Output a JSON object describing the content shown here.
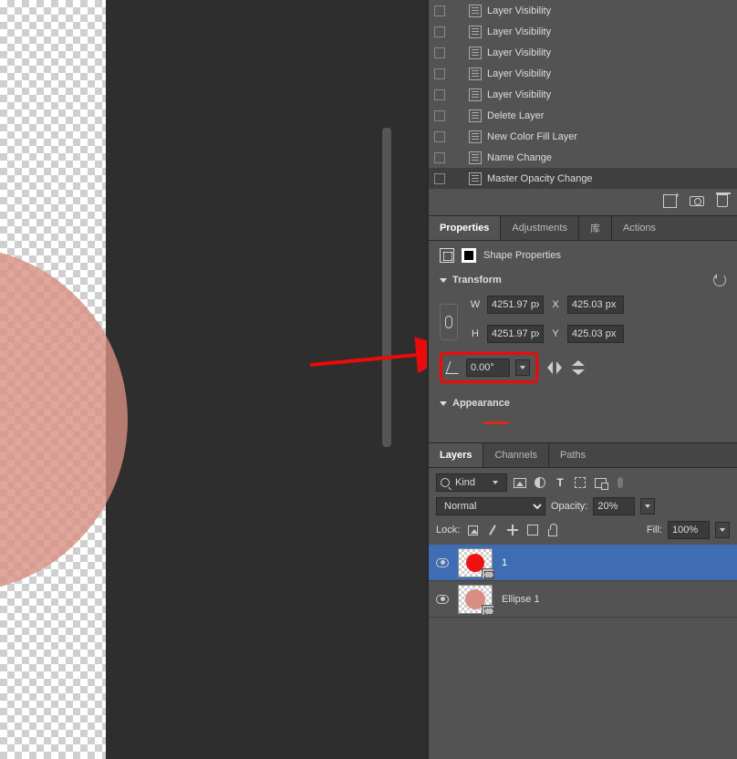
{
  "history": {
    "items": [
      {
        "label": "Layer Visibility",
        "selected": false
      },
      {
        "label": "Layer Visibility",
        "selected": false
      },
      {
        "label": "Layer Visibility",
        "selected": false
      },
      {
        "label": "Layer Visibility",
        "selected": false
      },
      {
        "label": "Layer Visibility",
        "selected": false
      },
      {
        "label": "Delete Layer",
        "selected": false
      },
      {
        "label": "New Color Fill Layer",
        "selected": false
      },
      {
        "label": "Name Change",
        "selected": false
      },
      {
        "label": "Master Opacity Change",
        "selected": true
      }
    ]
  },
  "tabs_props": {
    "properties": "Properties",
    "adjustments": "Adjustments",
    "libraries": "库",
    "actions": "Actions"
  },
  "props": {
    "shape_label": "Shape Properties",
    "transform": {
      "title": "Transform",
      "W_lbl": "W",
      "W": "4251.97 px",
      "H_lbl": "H",
      "H": "4251.97 px",
      "X_lbl": "X",
      "X": "425.03 px",
      "Y_lbl": "Y",
      "Y": "425.03 px",
      "angle": "0.00°"
    },
    "appearance": {
      "title": "Appearance"
    }
  },
  "tabs_layers": {
    "layers": "Layers",
    "channels": "Channels",
    "paths": "Paths"
  },
  "layers": {
    "kind": "Kind",
    "blend": "Normal",
    "opacity_lbl": "Opacity:",
    "opacity": "20%",
    "lock_lbl": "Lock:",
    "fill_lbl": "Fill:",
    "fill": "100%",
    "rows": [
      {
        "name": "1",
        "selected": true,
        "thumb": "red"
      },
      {
        "name": "Ellipse 1",
        "selected": false,
        "thumb": "salmon"
      }
    ]
  }
}
